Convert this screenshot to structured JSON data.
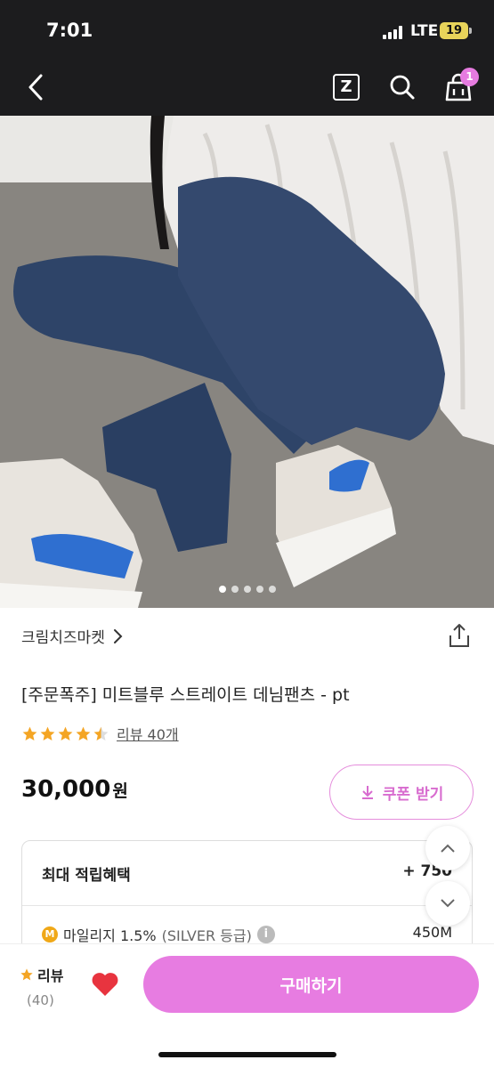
{
  "status_bar": {
    "time": "7:01",
    "network": "LTE",
    "battery": "19"
  },
  "header": {
    "cart_count": "1",
    "z_label": "Z"
  },
  "gallery": {
    "total": 5,
    "active_index": 0
  },
  "product": {
    "brand": "크림치즈마켓",
    "title": "[주문폭주] 미트블루 스트레이트 데님팬츠 - pt",
    "rating": 4.5,
    "review_link": "리뷰 40개",
    "price": "30,000",
    "price_unit": "원"
  },
  "coupon": {
    "label": "쿠폰 받기"
  },
  "benefits": {
    "title": "최대 적립혜택",
    "total": "+ 750",
    "mileage_label": "마일리지 1.5%",
    "mileage_grade": "(SILVER 등급)",
    "mileage_amount": "450M"
  },
  "bottom": {
    "review_label": "리뷰",
    "review_count": "(40)",
    "buy_label": "구매하기"
  },
  "colors": {
    "accent": "#e77ce1",
    "header_bg": "#1c1c1e",
    "star": "#f4a524"
  }
}
